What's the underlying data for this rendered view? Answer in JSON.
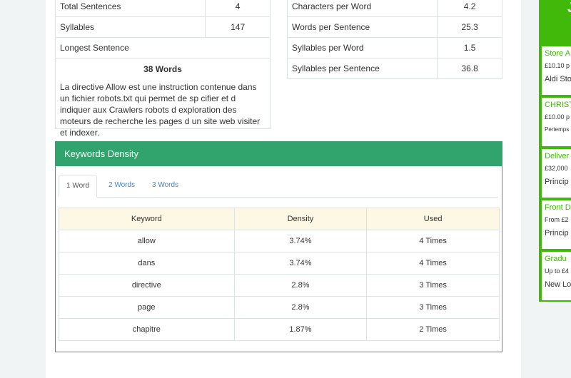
{
  "stats_left": [
    {
      "label": "Total Sentences",
      "value": "4"
    },
    {
      "label": "Syllables",
      "value": "147"
    },
    {
      "label": "Longest Sentence",
      "value": ""
    }
  ],
  "stats_right": [
    {
      "label": "Characters per Word",
      "value": "4.2"
    },
    {
      "label": "Words per Sentence",
      "value": "25.3"
    },
    {
      "label": "Syllables per Word",
      "value": "1.5"
    },
    {
      "label": "Syllables per Sentence",
      "value": "36.8"
    }
  ],
  "longest": {
    "count_label": "38 Words",
    "text": "La directive Allow est une instruction contenue dans un fichier robots.txt qui permet de sp cifier et d indiquer aux Crawlers robots d exploration des moteurs de recherche les pages d un site web visiter et indexer."
  },
  "density": {
    "title": "Keywords Density",
    "tabs": [
      "1 Word",
      "2 Words",
      "3 Words"
    ],
    "columns": [
      "Keyword",
      "Density",
      "Used"
    ],
    "rows": [
      [
        "allow",
        "3.74%",
        "4 Times"
      ],
      [
        "dans",
        "3.74%",
        "4 Times"
      ],
      [
        "directive",
        "2.8%",
        "3 Times"
      ],
      [
        "page",
        "2.8%",
        "3 Times"
      ],
      [
        "chapitre",
        "1.87%",
        "2 Times"
      ]
    ]
  },
  "sidebar": {
    "logo": "J",
    "items": [
      {
        "title": "Store A",
        "sub": "£10.10 p",
        "place": "Aldi Sto"
      },
      {
        "title": "CHRIST",
        "sub": "£10.00 p",
        "place": "Pertemps"
      },
      {
        "title": "Deliver",
        "sub": "£32,000",
        "place": "Princip"
      },
      {
        "title": "Front D",
        "sub": "From £2",
        "place": "Princip"
      },
      {
        "title": "Gradu",
        "sub": "Up to £4",
        "place": "New Lo"
      }
    ]
  },
  "colors": {
    "accent": "#30a46c",
    "sidebar": "#41b90b",
    "header_row": "#fcf8e3",
    "tab_link": "#3f84c6"
  }
}
